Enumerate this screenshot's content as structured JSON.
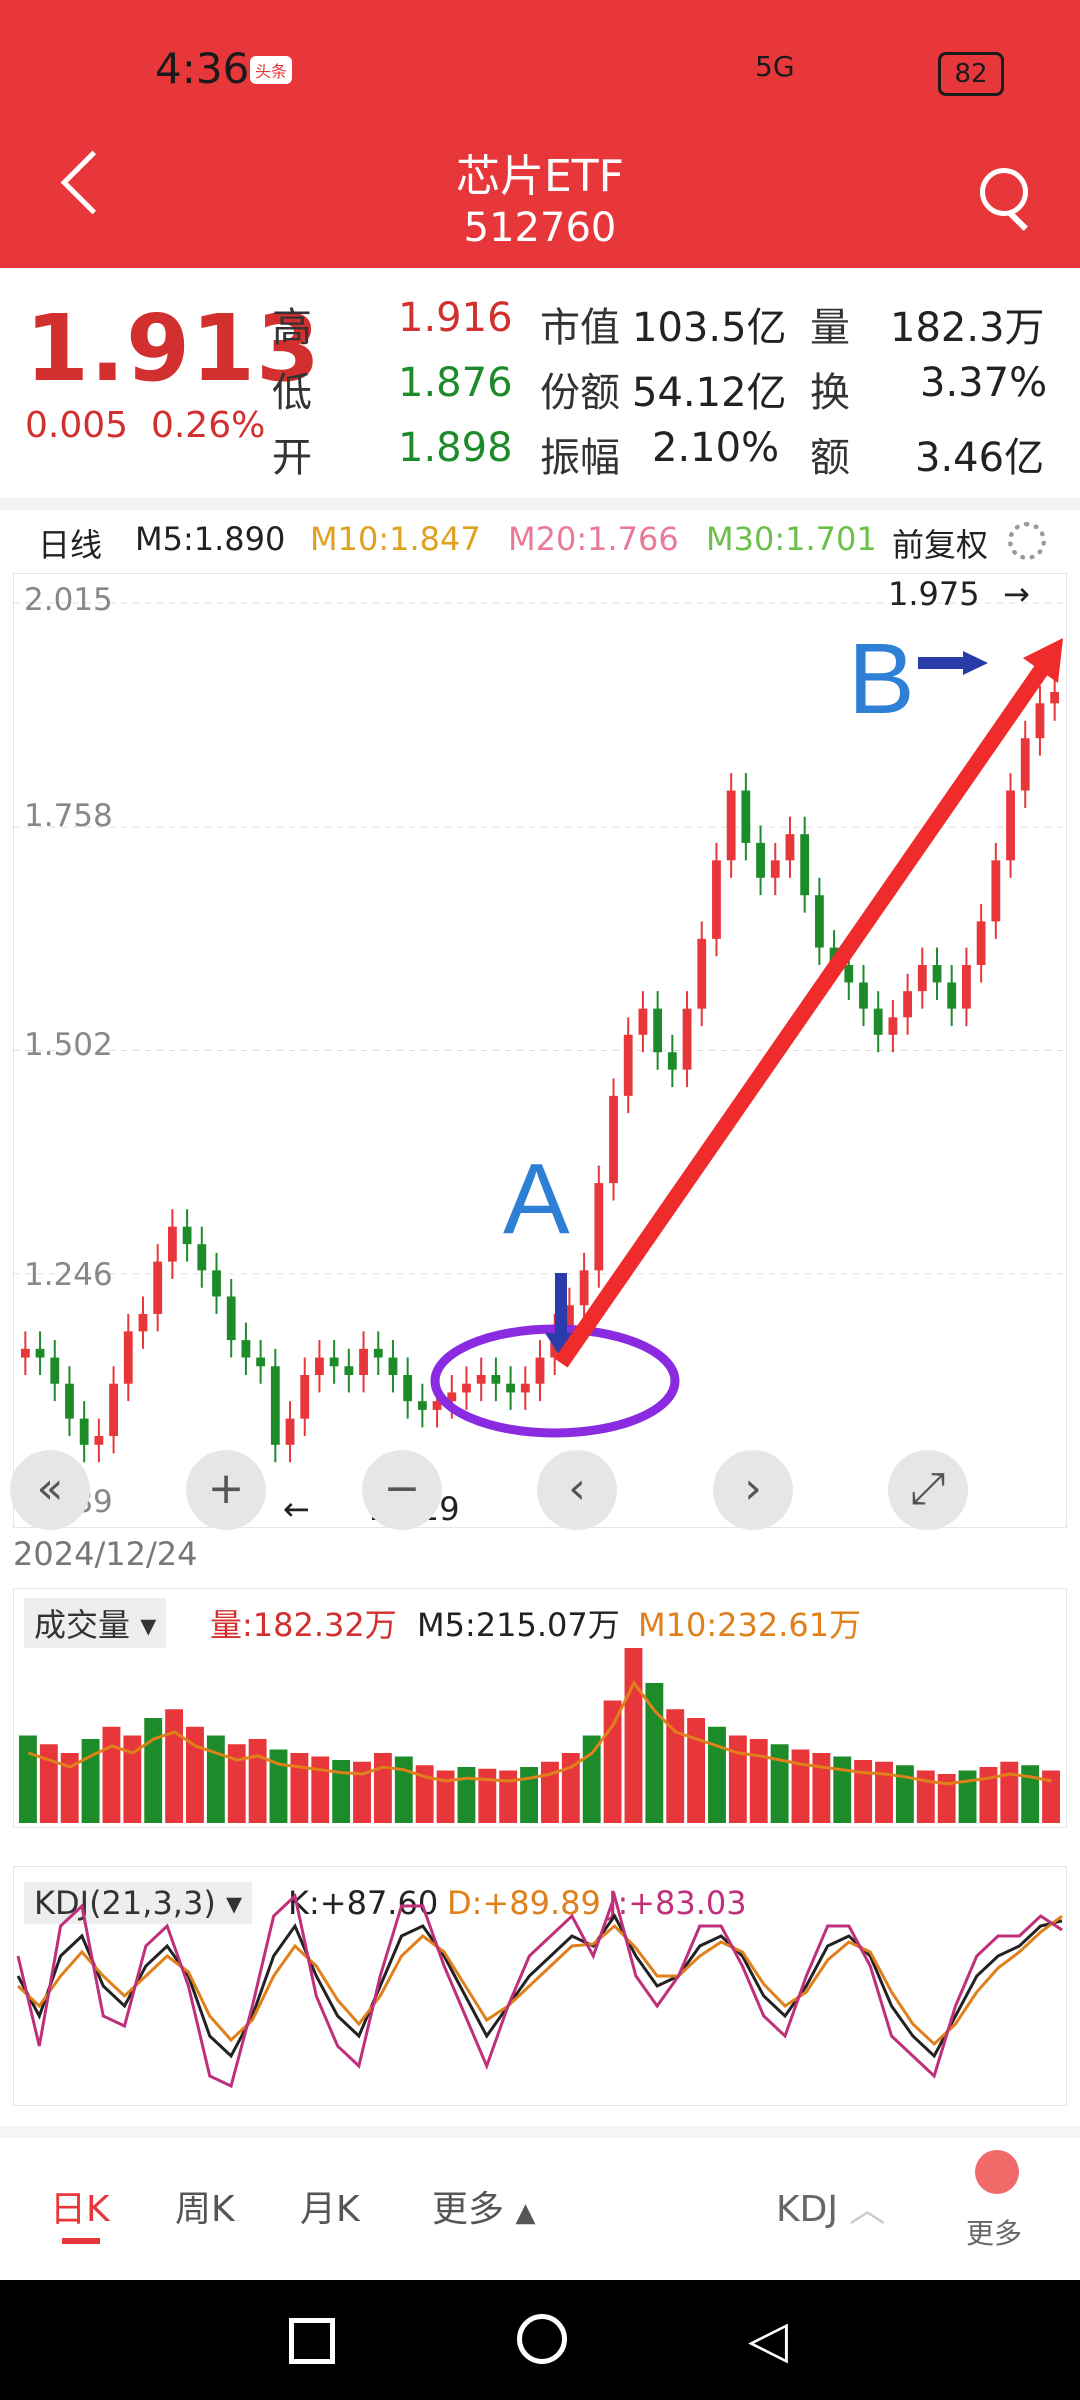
{
  "status_bar": {
    "time": "4:36",
    "badge": "头条",
    "network": "5G",
    "battery": "82"
  },
  "header": {
    "title": "芯片ETF",
    "code": "512760"
  },
  "quote": {
    "price": "1.913",
    "change": "0.005",
    "change_pct": "0.26%",
    "high_label": "高",
    "high": "1.916",
    "low_label": "低",
    "low": "1.876",
    "open_label": "开",
    "open": "1.898",
    "mktcap_label": "市值",
    "mktcap": "103.5亿",
    "shares_label": "份额",
    "shares": "54.12亿",
    "amp_label": "振幅",
    "amp": "2.10%",
    "vol_label": "量",
    "vol": "182.3万",
    "turnover_label": "换",
    "turnover": "3.37%",
    "amount_label": "额",
    "amount": "3.46亿"
  },
  "chart_header": {
    "period": "日线",
    "m5": "M5:1.890",
    "m10": "M10:1.847",
    "m20": "M20:1.766",
    "m30": "M30:1.701",
    "adjust": "前复权"
  },
  "colors": {
    "up": "#e8373a",
    "down": "#1e8b2a",
    "m5": "#222222",
    "m10": "#e0a020",
    "m20": "#e87a98",
    "m30": "#6cc04a",
    "annot_blue": "#2e7fd6",
    "annot_purple": "#8a2be2"
  },
  "chart_data": [
    {
      "type": "candlestick",
      "title": "日线",
      "ylim": [
        0.989,
        2.015
      ],
      "y_ticks": [
        "2.015",
        "1.758",
        "1.502",
        "1.246",
        "0.989"
      ],
      "start_date": "2024/12/24",
      "close_approx": [
        1.16,
        1.15,
        1.12,
        1.08,
        1.05,
        1.06,
        1.12,
        1.18,
        1.2,
        1.26,
        1.3,
        1.28,
        1.25,
        1.22,
        1.17,
        1.15,
        1.14,
        1.05,
        1.08,
        1.13,
        1.15,
        1.14,
        1.13,
        1.16,
        1.15,
        1.13,
        1.1,
        1.09,
        1.1,
        1.11,
        1.12,
        1.13,
        1.12,
        1.11,
        1.12,
        1.15,
        1.18,
        1.21,
        1.25,
        1.35,
        1.45,
        1.52,
        1.55,
        1.5,
        1.48,
        1.55,
        1.63,
        1.72,
        1.8,
        1.74,
        1.7,
        1.72,
        1.75,
        1.68,
        1.62,
        1.6,
        1.58,
        1.55,
        1.52,
        1.54,
        1.57,
        1.6,
        1.58,
        1.55,
        1.6,
        1.65,
        1.72,
        1.8,
        1.86,
        1.9,
        1.913
      ],
      "max_label": "1.975",
      "min_label": "1.029",
      "annotations": [
        "A",
        "B"
      ]
    },
    {
      "type": "bar",
      "title": "成交量",
      "series_label": "量:182.32万",
      "m5": "M5:215.07万",
      "m10": "M10:232.61万",
      "values_approx": [
        0.5,
        0.45,
        0.4,
        0.48,
        0.55,
        0.5,
        0.6,
        0.65,
        0.55,
        0.5,
        0.45,
        0.48,
        0.42,
        0.4,
        0.38,
        0.36,
        0.35,
        0.4,
        0.38,
        0.33,
        0.3,
        0.32,
        0.31,
        0.3,
        0.32,
        0.35,
        0.4,
        0.5,
        0.7,
        1.0,
        0.8,
        0.65,
        0.6,
        0.55,
        0.5,
        0.48,
        0.45,
        0.42,
        0.4,
        0.38,
        0.36,
        0.35,
        0.33,
        0.3,
        0.28,
        0.3,
        0.32,
        0.35,
        0.33,
        0.3
      ]
    },
    {
      "type": "line",
      "title": "KDJ",
      "selector": "KDJ(21,3,3)",
      "k": "K:+87.60",
      "d": "D:+89.89",
      "j": "J:+83.03",
      "series": [
        {
          "name": "K",
          "values": [
            60,
            40,
            70,
            80,
            55,
            45,
            65,
            75,
            60,
            30,
            20,
            40,
            70,
            85,
            60,
            40,
            30,
            55,
            80,
            85,
            70,
            50,
            30,
            45,
            60,
            70,
            80,
            75,
            90,
            70,
            55,
            60,
            75,
            80,
            70,
            50,
            40,
            55,
            75,
            80,
            70,
            45,
            30,
            20,
            40,
            60,
            70,
            75,
            85,
            87.6
          ]
        },
        {
          "name": "D",
          "values": [
            55,
            45,
            60,
            72,
            60,
            50,
            60,
            70,
            62,
            40,
            28,
            38,
            60,
            75,
            65,
            48,
            36,
            50,
            70,
            80,
            72,
            55,
            38,
            45,
            55,
            65,
            75,
            76,
            85,
            74,
            60,
            60,
            70,
            77,
            72,
            56,
            45,
            52,
            68,
            77,
            72,
            52,
            36,
            26,
            36,
            52,
            64,
            72,
            82,
            89.89
          ]
        },
        {
          "name": "J",
          "values": [
            70,
            25,
            85,
            95,
            40,
            35,
            75,
            85,
            55,
            10,
            5,
            45,
            90,
            100,
            50,
            25,
            15,
            60,
            95,
            95,
            65,
            40,
            15,
            45,
            70,
            80,
            90,
            70,
            100,
            60,
            45,
            60,
            85,
            85,
            65,
            40,
            30,
            60,
            85,
            85,
            65,
            30,
            20,
            10,
            45,
            70,
            80,
            80,
            90,
            83.03
          ]
        }
      ]
    }
  ],
  "nav": {
    "date": "2024/12/24"
  },
  "bottom_tabs": {
    "day": "日K",
    "week": "周K",
    "month": "月K",
    "more": "更多",
    "indicator": "KDJ",
    "more2": "更多"
  }
}
